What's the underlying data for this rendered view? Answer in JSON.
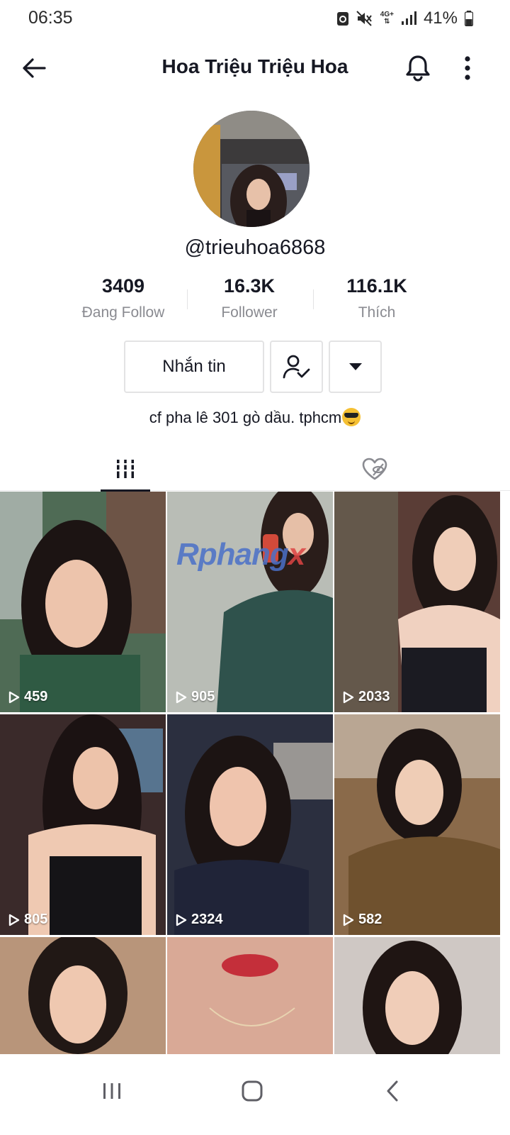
{
  "status_bar": {
    "time": "06:35",
    "network": "4G+",
    "battery": "41%",
    "icons": [
      "recycle-icon",
      "mute-icon",
      "network-4g-icon",
      "signal-icon",
      "battery-icon"
    ]
  },
  "header": {
    "title": "Hoa Triệu Triệu Hoa",
    "icons": [
      "back-arrow-icon",
      "bell-icon",
      "more-vertical-icon"
    ]
  },
  "profile": {
    "username": "@trieuhoa6868",
    "stats": [
      {
        "value": "3409",
        "label": "Đang Follow"
      },
      {
        "value": "16.3K",
        "label": "Follower"
      },
      {
        "value": "116.1K",
        "label": "Thích"
      }
    ],
    "buttons": {
      "message": "Nhắn tin",
      "friend_icon": "user-check-icon",
      "dropdown_icon": "caret-down-icon"
    },
    "bio": "cf pha lê 301 gò dầu. tphcm",
    "bio_emoji": "sunglasses-emoji"
  },
  "tabs": [
    {
      "name": "videos",
      "icon": "grid-bars-icon",
      "active": true
    },
    {
      "name": "liked",
      "icon": "heart-hidden-icon",
      "active": false
    }
  ],
  "watermark": {
    "main": "Rphang",
    "accent": "x"
  },
  "videos": [
    {
      "views": "459",
      "tone": "#4f6b55"
    },
    {
      "views": "905",
      "tone": "#3f5f58"
    },
    {
      "views": "2033",
      "tone": "#5a3d36"
    },
    {
      "views": "805",
      "tone": "#3a2a2a"
    },
    {
      "views": "2324",
      "tone": "#2b2f3f"
    },
    {
      "views": "582",
      "tone": "#8a6a4a"
    },
    {
      "views": "",
      "tone": "#b8957a"
    },
    {
      "views": "",
      "tone": "#d9a996"
    },
    {
      "views": "",
      "tone": "#cfc8c4"
    }
  ],
  "navbar": {
    "icons": [
      "recent-apps-icon",
      "home-icon",
      "nav-back-icon"
    ]
  },
  "colors": {
    "text_primary": "#161823",
    "text_secondary": "#8a8b91",
    "border": "#e3e3e4"
  }
}
